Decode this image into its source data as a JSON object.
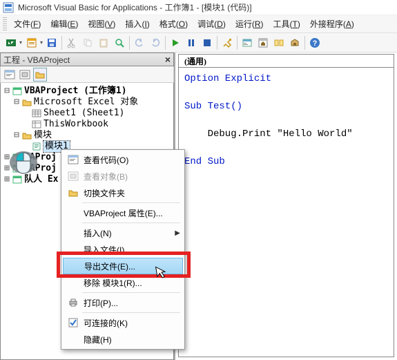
{
  "title": "Microsoft Visual Basic for Applications - 工作簿1 - [模块1 (代码)]",
  "menubar": [
    {
      "label": "文件",
      "key": "F"
    },
    {
      "label": "编辑",
      "key": "E"
    },
    {
      "label": "视图",
      "key": "V"
    },
    {
      "label": "插入",
      "key": "I"
    },
    {
      "label": "格式",
      "key": "O"
    },
    {
      "label": "调试",
      "key": "D"
    },
    {
      "label": "运行",
      "key": "R"
    },
    {
      "label": "工具",
      "key": "T"
    },
    {
      "label": "外接程序",
      "key": "A"
    }
  ],
  "project_panel": {
    "title": "工程 - VBAProject"
  },
  "tree": {
    "root": "VBAProject (工作簿1)",
    "grpExcel": "Microsoft Excel 对象",
    "sheet1": "Sheet1 (Sheet1)",
    "thiswb": "ThisWorkbook",
    "grpMod": "模块",
    "mod1": "模块1",
    "proj2": "3AProj",
    "proj3": "3AProj",
    "proj4": "队人 Ex"
  },
  "code_header": "(通用)",
  "code": {
    "l1": "Option Explicit",
    "l2": "Sub Test()",
    "l3": "    Debug.Print \"Hello World\"",
    "l4": "End Sub"
  },
  "ctx": {
    "view_code": "查看代码(O)",
    "view_obj": "查看对象(B)",
    "toggle_fld": "切换文件夹",
    "props": "VBAProject 属性(E)...",
    "insert": "插入(N)",
    "import": "导入文件(I)...",
    "export": "导出文件(E)...",
    "remove": "移除 模块1(R)...",
    "print": "打印(P)...",
    "dockable": "可连接的(K)",
    "hide": "隐藏(H)"
  }
}
